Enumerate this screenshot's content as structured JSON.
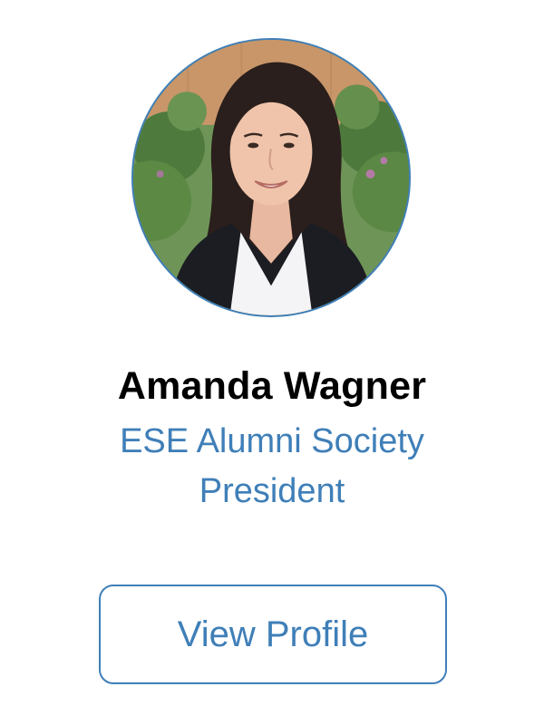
{
  "profile": {
    "name": "Amanda Wagner",
    "role": "ESE Alumni Society President",
    "button_label": "View Profile"
  },
  "colors": {
    "accent": "#3f7fb8",
    "name_text": "#000000",
    "background": "#ffffff"
  },
  "icons": {
    "photo": "profile-photo"
  }
}
